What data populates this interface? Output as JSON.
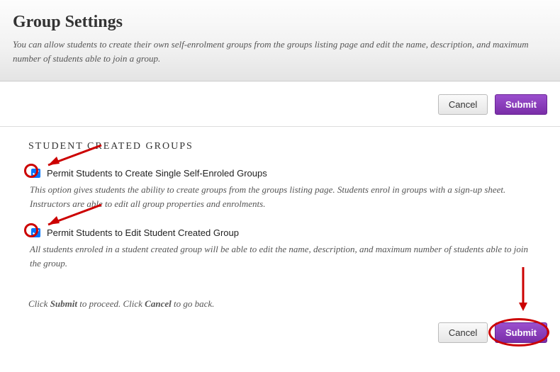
{
  "header": {
    "title": "Group Settings",
    "subtitle": "You can allow students to create their own self-enrolment groups from the groups listing page and edit the name, description, and maximum number of students able to join a group."
  },
  "buttons": {
    "cancel": "Cancel",
    "submit": "Submit"
  },
  "section": {
    "heading": "STUDENT CREATED GROUPS",
    "option1": {
      "label": "Permit Students to Create Single Self-Enroled Groups",
      "description": "This option gives students the ability to create groups from the groups listing page. Students enrol in groups with a sign-up sheet. Instructors are able to edit all group properties and enrolments.",
      "checked": true
    },
    "option2": {
      "label": "Permit Students to Edit Student Created Group",
      "description": "All students enroled in a student created group will be able to edit the name, description, and maximum number of students able to join the group.",
      "checked": true
    }
  },
  "instruction": {
    "prefix": "Click ",
    "submit_word": "Submit",
    "middle": " to proceed. Click ",
    "cancel_word": "Cancel",
    "suffix": " to go back."
  }
}
